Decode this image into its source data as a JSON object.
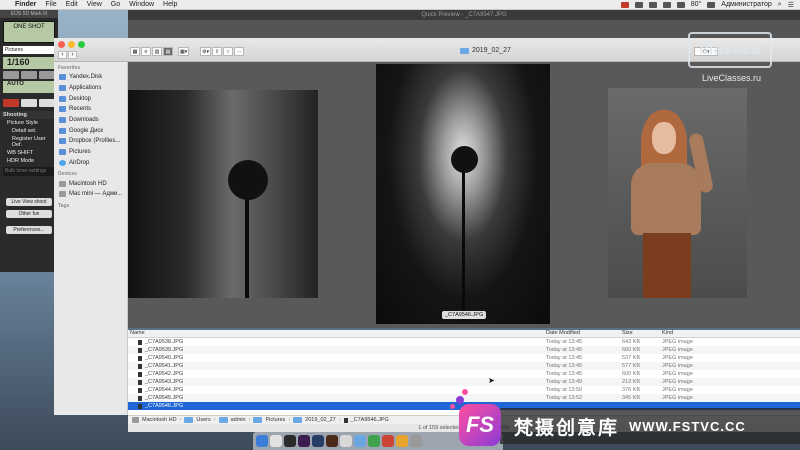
{
  "menubar": {
    "app": "Finder",
    "items": [
      "File",
      "Edit",
      "View",
      "Go",
      "Window",
      "Help"
    ],
    "battery": "80°",
    "user": "Администратор"
  },
  "canon": {
    "title": "EOS 5D Mark III",
    "mode": "ONE SHOT",
    "folder": "Pictures",
    "shutter": "1/160",
    "iso_row": "AUTO",
    "section": "Shooting",
    "menu": [
      "Picture Style",
      "Detail set.",
      "Register User Def.",
      "WB SHIFT",
      "HDR Mode"
    ],
    "input_placeholder": "Bulb timer settings",
    "live_view": "Live View shoot",
    "other": "Other fun",
    "preferences": "Preferences..."
  },
  "quicklook": {
    "title": "Quick Preview - _C7A9547.JPG",
    "caption": "_C7A9546.JPG"
  },
  "finder": {
    "folder": "2019_02_27",
    "favorites_label": "Favorites",
    "favorites": [
      "Yandex.Disk",
      "Applications",
      "Desktop",
      "Recents",
      "Downloads",
      "Google Диск",
      "Dropbox (Profiles...",
      "Pictures",
      "AirDrop"
    ],
    "devices_label": "Devices",
    "devices": [
      "Macintosh HD",
      "Mac mini — Адми..."
    ],
    "tags_label": "Tags"
  },
  "list": {
    "headers": {
      "name": "Name",
      "date": "Date Modified",
      "size": "Size",
      "kind": "Kind"
    },
    "rows": [
      {
        "name": "_C7A9538.JPG",
        "date": "Today at 13:45",
        "size": "643 KB",
        "kind": "JPEG image"
      },
      {
        "name": "_C7A9539.JPG",
        "date": "Today at 13:45",
        "size": "660 KB",
        "kind": "JPEG image"
      },
      {
        "name": "_C7A9540.JPG",
        "date": "Today at 13:45",
        "size": "537 KB",
        "kind": "JPEG image"
      },
      {
        "name": "_C7A9541.JPG",
        "date": "Today at 13:45",
        "size": "577 KB",
        "kind": "JPEG image"
      },
      {
        "name": "_C7A9542.JPG",
        "date": "Today at 13:45",
        "size": "600 KB",
        "kind": "JPEG image"
      },
      {
        "name": "_C7A9543.JPG",
        "date": "Today at 13:49",
        "size": "213 KB",
        "kind": "JPEG image"
      },
      {
        "name": "_C7A9544.JPG",
        "date": "Today at 13:50",
        "size": "376 KB",
        "kind": "JPEG image"
      },
      {
        "name": "_C7A9545.JPG",
        "date": "Today at 13:52",
        "size": "345 KB",
        "kind": "JPEG image"
      },
      {
        "name": "_C7A9546.JPG",
        "date": "",
        "size": "",
        "kind": ""
      }
    ],
    "selected_index": 8
  },
  "pathbar": [
    "Macintosh HD",
    "Users",
    "admin",
    "Pictures",
    "2019_02_27",
    "_C7A9546.JPG"
  ],
  "status": "1 of 159 selected, 59,88 GB available",
  "watermark": {
    "logo": "classes",
    "site": "LiveClasses.ru",
    "fs_letters": "FS",
    "fs_cn": "梵摄创意库",
    "fs_url": "WWW.FSTVC.CC"
  },
  "colors": {
    "selection": "#1f66d6",
    "fs_pink": "#ff4fa0",
    "fs_purple": "#8b3bd6"
  }
}
